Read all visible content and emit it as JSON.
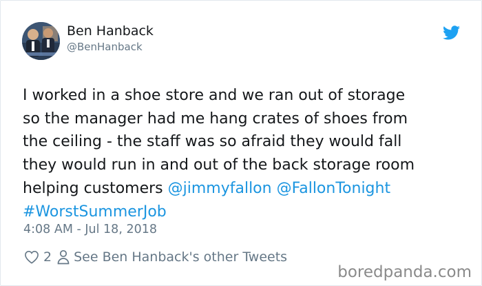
{
  "author": {
    "name": "Ben Hanback",
    "handle": "@BenHanback",
    "avatar_icon": "avatar-photo"
  },
  "tweet": {
    "lines": [
      "I worked in a shoe store and we ran out of storage",
      "so the manager had me hang crates of shoes from",
      "the ceiling - the staff was so afraid they would fall",
      "they would run in and out of the back storage room"
    ],
    "last_line_prefix": "helping customers ",
    "mention_1": "@jimmyfallon",
    "mention_2": "@FallonTonight",
    "hashtag": "#WorstSummerJob",
    "timestamp": "4:08 AM - Jul 18, 2018"
  },
  "actions": {
    "like_count": "2",
    "other_tweets_label": "See Ben Hanback's other Tweets",
    "like_icon": "heart-icon",
    "profile_icon": "person-icon"
  },
  "watermark": "boredpanda.com",
  "colors": {
    "link": "#1b95e0",
    "text": "#14171a",
    "secondary": "#657786",
    "twitter_blue": "#1da1f2"
  }
}
